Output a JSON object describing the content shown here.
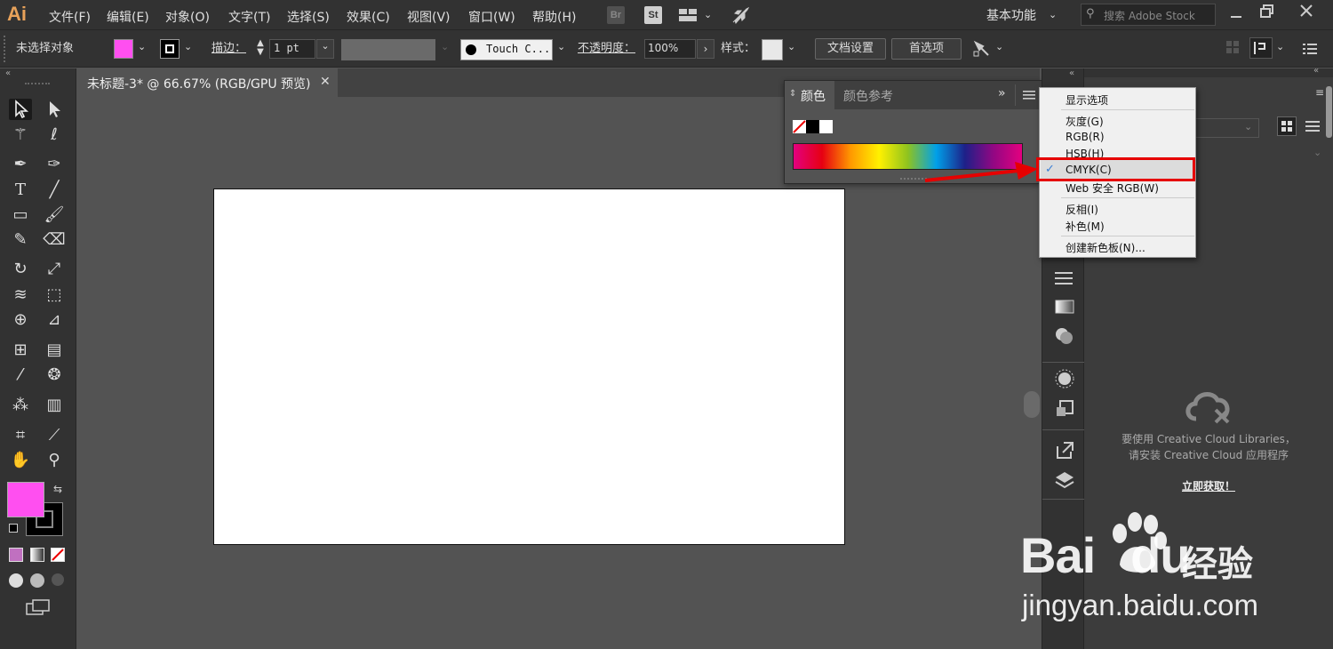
{
  "app": {
    "logo": "Ai"
  },
  "menubar": {
    "items": [
      "文件(F)",
      "编辑(E)",
      "对象(O)",
      "文字(T)",
      "选择(S)",
      "效果(C)",
      "视图(V)",
      "窗口(W)",
      "帮助(H)"
    ],
    "br": "Br",
    "st": "St",
    "workspace": "基本功能",
    "search_placeholder": "搜索 Adobe Stock"
  },
  "controlbar": {
    "selection": "未选择对象",
    "stroke_label": "描边：",
    "stroke_value": "1 pt",
    "brush": "Touch C...",
    "opacity_label": "不透明度：",
    "opacity_value": "100%",
    "style_label": "样式：",
    "doc_setup": "文档设置",
    "prefs": "首选项"
  },
  "colors": {
    "fill": "#ff4ff0",
    "accent": "#e60000"
  },
  "document": {
    "tab_title": "未标题-3* @ 66.67% (RGB/GPU 预览)"
  },
  "color_panel": {
    "tab_active": "颜色",
    "tab_inactive": "颜色参考"
  },
  "dropdown": {
    "items": [
      "显示选项",
      "灰度(G)",
      "RGB(R)",
      "HSB(H)",
      "CMYK(C)",
      "Web 安全 RGB(W)",
      "反相(I)",
      "补色(M)",
      "创建新色板(N)..."
    ],
    "checked": "CMYK(C)"
  },
  "libraries": {
    "line1": "要使用 Creative Cloud Libraries，",
    "line2": "请安装 Creative Cloud 应用程序",
    "link": "立即获取！"
  },
  "watermark": {
    "brand": "Bai",
    "brand2": "du",
    "suffix": "经验",
    "url": "jingyan.baidu.com"
  }
}
